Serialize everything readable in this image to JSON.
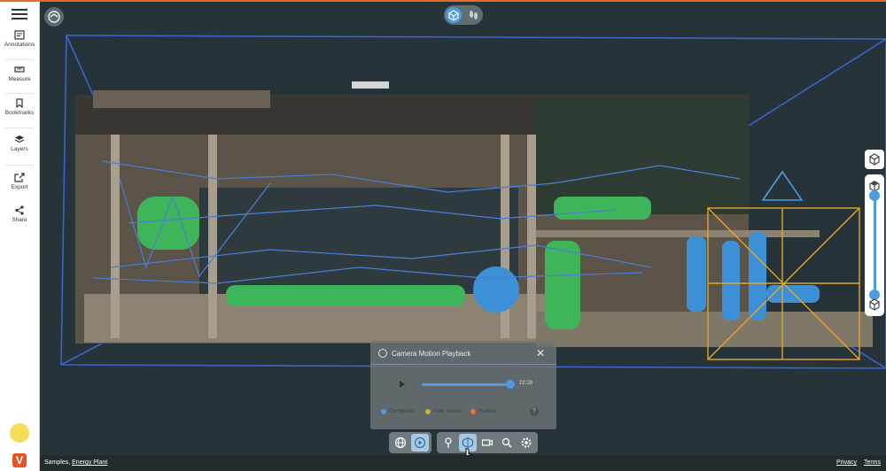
{
  "sidebar": {
    "items": [
      {
        "label": "Annotations",
        "icon": "annotations-icon"
      },
      {
        "label": "Measure",
        "icon": "ruler-icon"
      },
      {
        "label": "Bookmarks",
        "icon": "bookmark-icon"
      },
      {
        "label": "Layers",
        "icon": "layers-icon"
      },
      {
        "label": "Export",
        "icon": "export-icon"
      },
      {
        "label": "Share",
        "icon": "share-icon"
      }
    ]
  },
  "camera_playback": {
    "title": "Camera Motion Playback",
    "progress": 1.0,
    "time": "22:26",
    "legend": [
      {
        "label": "Completed",
        "color": "#4d9be0"
      },
      {
        "label": "Over speed",
        "color": "#c9b441"
      },
      {
        "label": "Rushed",
        "color": "#e0763a"
      }
    ],
    "help": "?"
  },
  "footer": {
    "project_prefix": "Samples,",
    "project_link": "Energy Plant",
    "privacy": "Privacy",
    "terms": "Terms"
  },
  "right_controls": {
    "slider_level_top": 1.0,
    "slider_level_bottom": 0.0
  },
  "colors": {
    "accent": "#4d9be0",
    "selection_box": "#e2a623",
    "scene_background": "#263439",
    "brand": "#e35426"
  }
}
